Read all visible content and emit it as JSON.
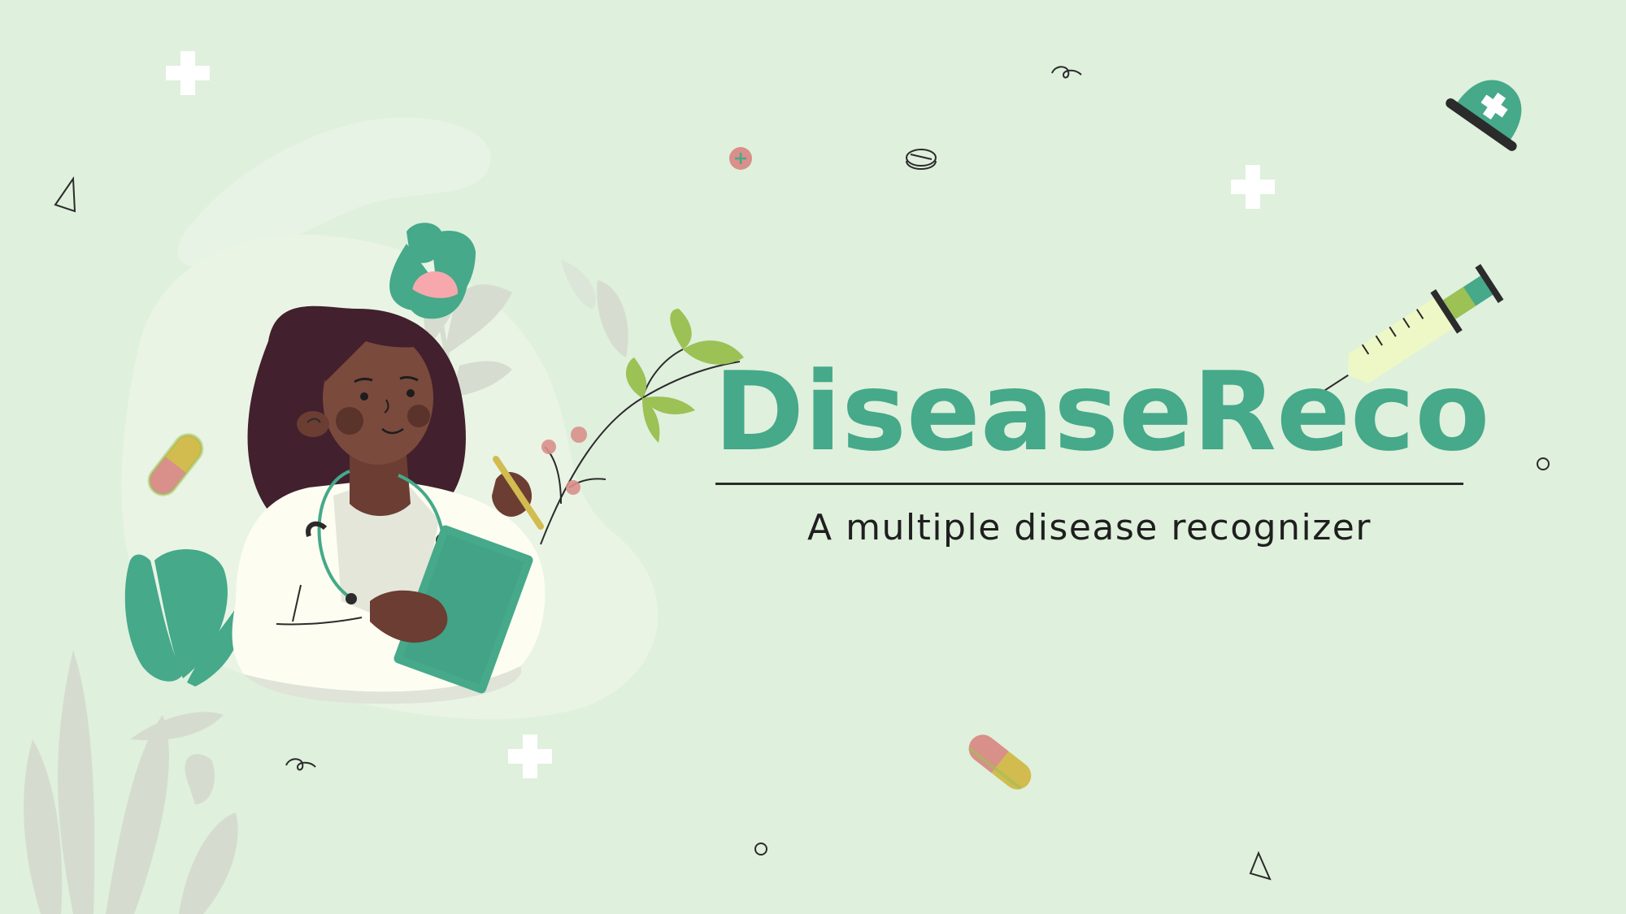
{
  "slide": {
    "title": "DiseaseReco",
    "subtitle": "A multiple disease recognizer"
  },
  "colors": {
    "background": "#dff0dd",
    "brand_teal": "#45a98a",
    "text_dark": "#1f1f1f",
    "pill_yellow": "#d2bb4f",
    "pill_pink": "#d98f8a",
    "syringe_light": "#eef8c6",
    "leaf_green": "#9cc155"
  },
  "icons": [
    "doctor-illustration",
    "flower-icon",
    "leaf-branch-icon",
    "pill-icon",
    "cross-icon",
    "syringe-icon",
    "medical-cap-icon",
    "tablet-icon",
    "triangle-icon",
    "circle-icon",
    "squiggle-icon",
    "plant-icon"
  ]
}
